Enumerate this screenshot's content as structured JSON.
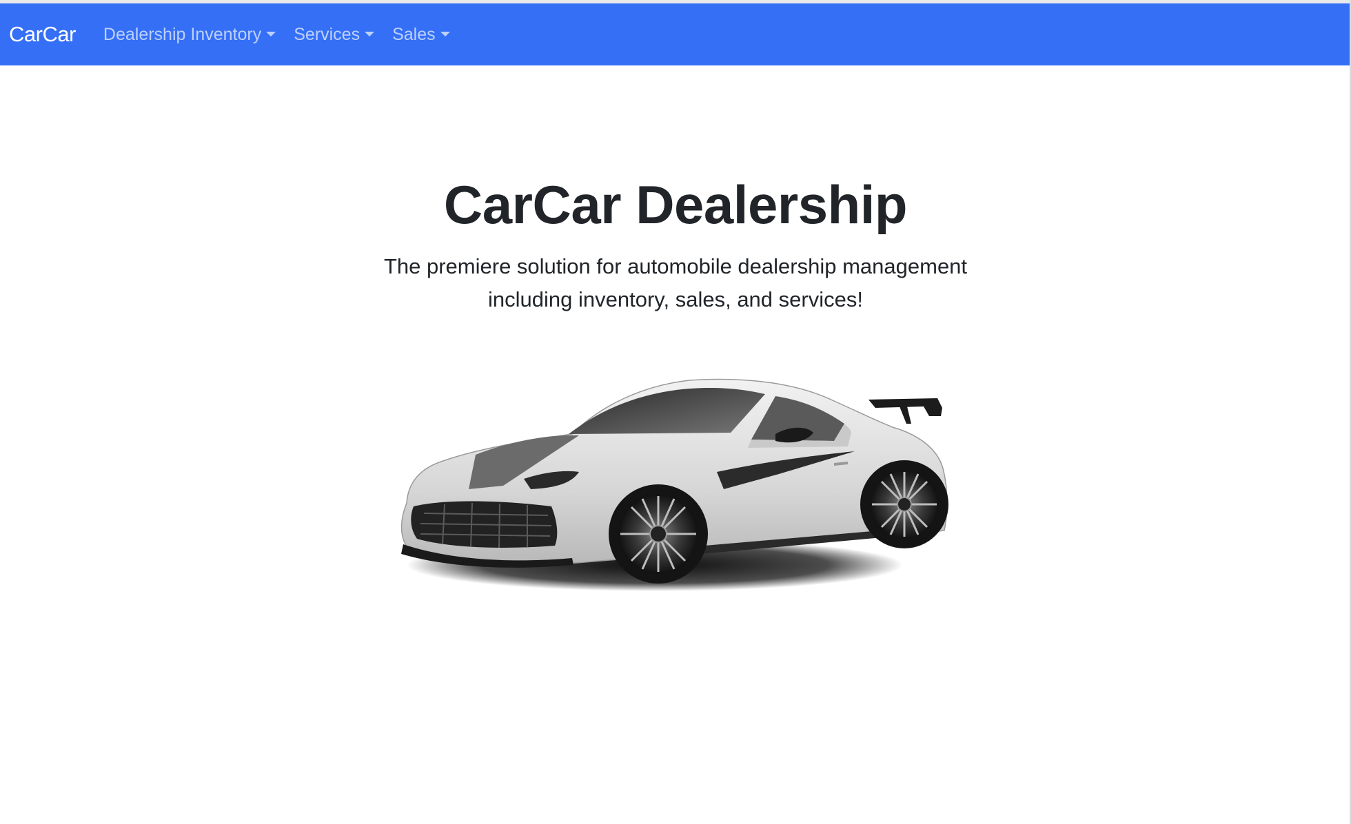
{
  "navbar": {
    "brand": "CarCar",
    "items": [
      {
        "label": "Dealership Inventory",
        "icon": "caret-down-icon"
      },
      {
        "label": "Services",
        "icon": "caret-down-icon"
      },
      {
        "label": "Sales",
        "icon": "caret-down-icon"
      }
    ],
    "color": "#346ff6"
  },
  "hero": {
    "title": "CarCar Dealership",
    "lead": "The premiere solution for automobile dealership management including inventory, sales, and services!",
    "image": "sports-car-image"
  }
}
